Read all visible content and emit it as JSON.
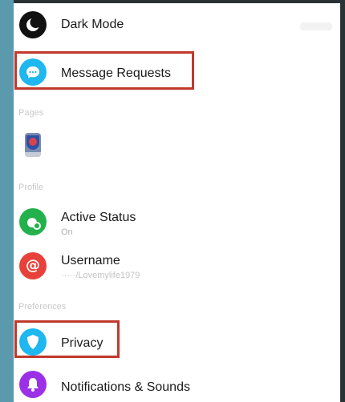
{
  "items": {
    "dark_mode": {
      "label": "Dark Mode",
      "icon": "moon-icon",
      "icon_bg": "#111111"
    },
    "message_requests": {
      "label": "Message Requests",
      "icon": "chat-bubble-icon",
      "icon_bg": "#1fb7ef"
    },
    "page_item": {
      "icon": "page-avatar-icon"
    },
    "active_status": {
      "label": "Active Status",
      "value": "On",
      "icon": "active-status-icon",
      "icon_bg": "#22b14c"
    },
    "username": {
      "label": "Username",
      "value": "·····/Lovemylife1979",
      "icon": "at-sign-icon",
      "icon_bg": "#e8413b"
    },
    "privacy": {
      "label": "Privacy",
      "icon": "shield-icon",
      "icon_bg": "#1fb7ef"
    },
    "notifications": {
      "label": "Notifications & Sounds",
      "icon": "bell-icon",
      "icon_bg": "#9b30e6"
    }
  },
  "sections": {
    "pages": "Pages",
    "profile": "Profile",
    "preferences": "Preferences"
  },
  "highlight_color": "#c0392b"
}
